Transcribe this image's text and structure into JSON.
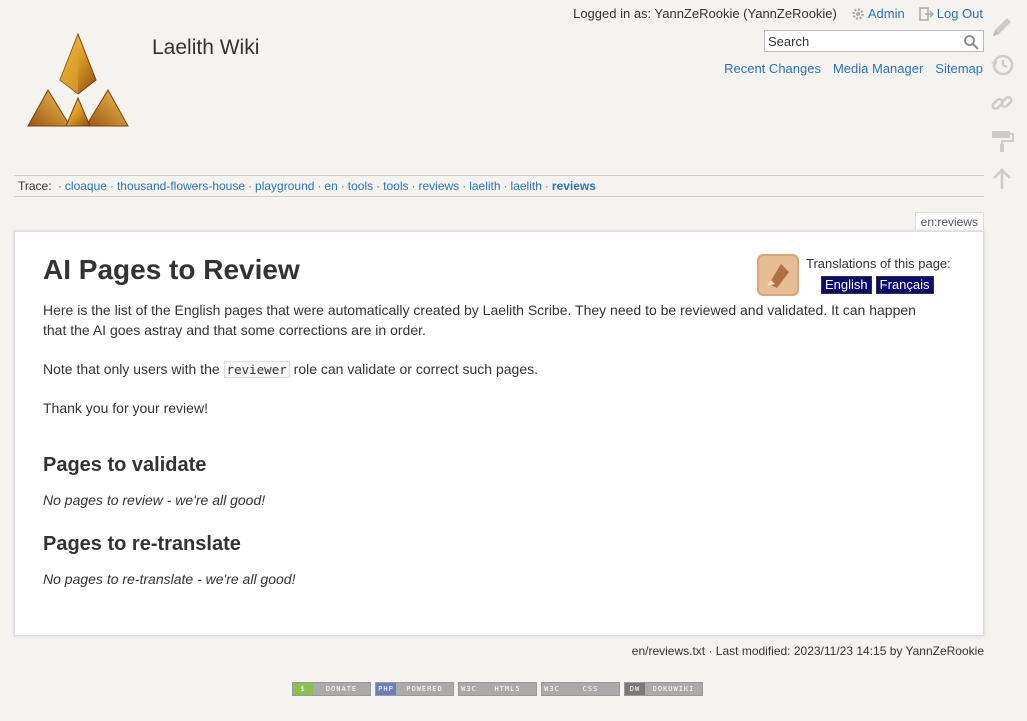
{
  "header": {
    "site_title": "Laelith Wiki",
    "logged_in_text": "Logged in as: YannZeRookie (YannZeRookie)",
    "admin_label": "Admin",
    "logout_label": "Log Out",
    "search_placeholder": "Search",
    "sitetools": [
      "Recent Changes",
      "Media Manager",
      "Sitemap"
    ]
  },
  "page_tools": [
    "pencil-icon",
    "history-icon",
    "link-icon",
    "paint-roller-icon",
    "arrow-up-icon"
  ],
  "breadcrumbs": {
    "label": "Trace:",
    "items": [
      "cloaque",
      "thousand-flowers-house",
      "playground",
      "en",
      "tools",
      "tools",
      "reviews",
      "laelith",
      "laelith"
    ],
    "current": "reviews"
  },
  "page_id": "en:reviews",
  "content": {
    "title": "AI Pages to Review",
    "intro": "Here is the list of the English pages that were automatically created by Laelith Scribe. They need to be reviewed and validated. It can happen that the AI goes astray and that some corrections are in order.",
    "note_before": "Note that only users with the ",
    "note_code": "reviewer",
    "note_after": " role can validate or correct such pages.",
    "thanks": "Thank you for your review!",
    "validate_heading": "Pages to validate",
    "validate_empty": "No pages to review - we're all good!",
    "retranslate_heading": "Pages to re-translate",
    "retranslate_empty": "No pages to re-translate - we're all good!"
  },
  "translation": {
    "label": "Translations of this page:",
    "languages": [
      "English",
      "Français"
    ]
  },
  "docinfo": "en/reviews.txt · Last modified: 2023/11/23 14:15 by YannZeRookie",
  "badges": [
    {
      "icon": "$",
      "text": "DONATE",
      "color": "#8cbf4f"
    },
    {
      "icon": "PHP",
      "text": "POWERED",
      "color": "#6c7eb7"
    },
    {
      "icon": "W3C",
      "text": "HTML5",
      "color": "#aaaaaa"
    },
    {
      "icon": "W3C",
      "text": "CSS",
      "color": "#aaaaaa"
    },
    {
      "icon": "DW",
      "text": "DOKUWIKI",
      "color": "#7a7a7a"
    }
  ],
  "colors": {
    "link": "#2b73b7",
    "background": "#f5f3f0",
    "language_badge": "#0b0b6f"
  }
}
